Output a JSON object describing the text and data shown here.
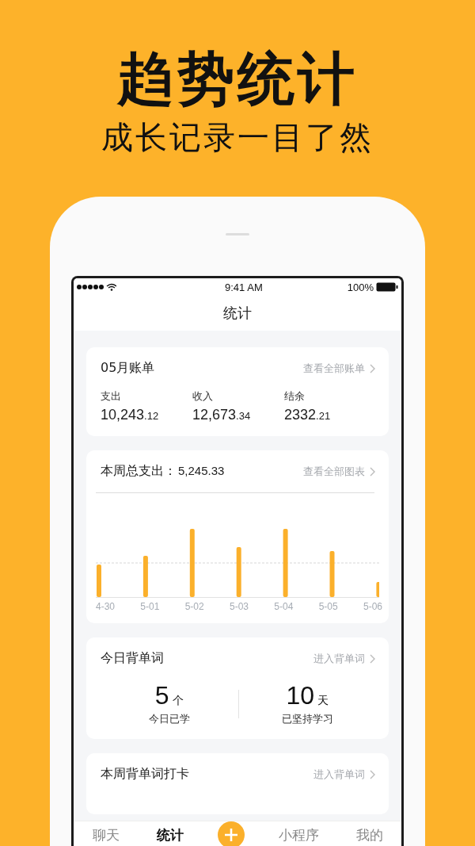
{
  "headline": "趋势统计",
  "subheadline": "成长记录一目了然",
  "status_bar": {
    "time": "9:41 AM",
    "battery": "100%"
  },
  "nav": {
    "title": "统计"
  },
  "bill_card": {
    "title": "05月账单",
    "link": "查看全部账单",
    "stats": [
      {
        "label": "支出",
        "value": "10,243",
        "decimals": ".12"
      },
      {
        "label": "收入",
        "value": "12,673",
        "decimals": ".34"
      },
      {
        "label": "结余",
        "value": "2332",
        "decimals": ".21"
      }
    ]
  },
  "week_card": {
    "title": "本周总支出：",
    "amount": "5,245.33",
    "link": "查看全部图表",
    "axis_labels": [
      "4-30",
      "5-01",
      "5-02",
      "5-03",
      "5-04",
      "5-05",
      "5-06"
    ]
  },
  "words_card": {
    "title": "今日背单词",
    "link": "进入背单词",
    "stats": [
      {
        "value": "5",
        "unit": "个",
        "label": "今日已学"
      },
      {
        "value": "10",
        "unit": "天",
        "label": "已坚持学习"
      }
    ]
  },
  "checkin_card": {
    "title": "本周背单词打卡",
    "link": "进入背单词"
  },
  "tabs": [
    {
      "label": "聊天",
      "kind": "text",
      "selected": false
    },
    {
      "label": "统计",
      "kind": "text",
      "selected": true
    },
    {
      "kind": "add",
      "selected": false
    },
    {
      "label": "小程序",
      "kind": "text",
      "selected": false
    },
    {
      "label": "我的",
      "kind": "text",
      "selected": false
    }
  ]
}
